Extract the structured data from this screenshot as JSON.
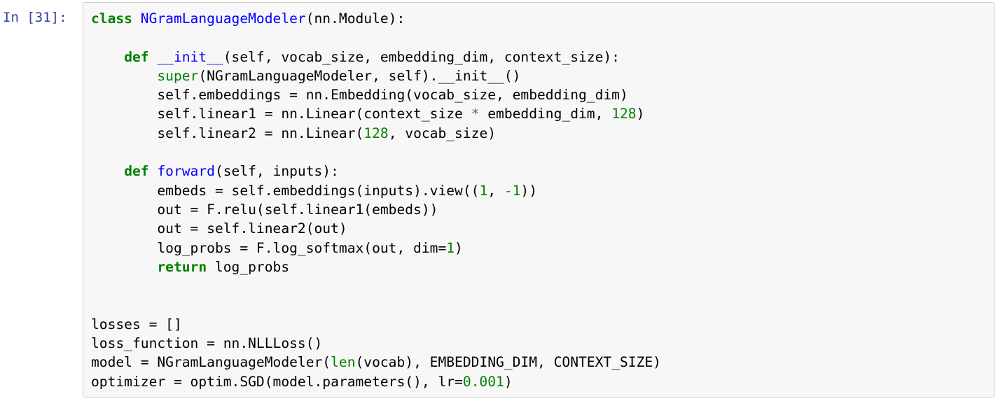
{
  "notebook": {
    "cell": {
      "prompt": "In [31]:",
      "language": "python",
      "lines": [
        [
          {
            "t": "kw",
            "v": "class"
          },
          {
            "t": "",
            "v": " "
          },
          {
            "t": "cls",
            "v": "NGramLanguageModeler"
          },
          {
            "t": "",
            "v": "(nn.Module):"
          }
        ],
        [],
        [
          {
            "t": "",
            "v": "    "
          },
          {
            "t": "kw",
            "v": "def"
          },
          {
            "t": "",
            "v": " "
          },
          {
            "t": "fn",
            "v": "__init__"
          },
          {
            "t": "",
            "v": "(self, vocab_size, embedding_dim, context_size):"
          }
        ],
        [
          {
            "t": "",
            "v": "        "
          },
          {
            "t": "bi",
            "v": "super"
          },
          {
            "t": "",
            "v": "(NGramLanguageModeler, self).__init__()"
          }
        ],
        [
          {
            "t": "",
            "v": "        self.embeddings = nn.Embedding(vocab_size, embedding_dim)"
          }
        ],
        [
          {
            "t": "",
            "v": "        self.linear1 = nn.Linear(context_size "
          },
          {
            "t": "op",
            "v": "*"
          },
          {
            "t": "",
            "v": " embedding_dim, "
          },
          {
            "t": "num",
            "v": "128"
          },
          {
            "t": "",
            "v": ")"
          }
        ],
        [
          {
            "t": "",
            "v": "        self.linear2 = nn.Linear("
          },
          {
            "t": "num",
            "v": "128"
          },
          {
            "t": "",
            "v": ", vocab_size)"
          }
        ],
        [],
        [
          {
            "t": "",
            "v": "    "
          },
          {
            "t": "kw",
            "v": "def"
          },
          {
            "t": "",
            "v": " "
          },
          {
            "t": "fn",
            "v": "forward"
          },
          {
            "t": "",
            "v": "(self, inputs):"
          }
        ],
        [
          {
            "t": "",
            "v": "        embeds = self.embeddings(inputs).view(("
          },
          {
            "t": "num",
            "v": "1"
          },
          {
            "t": "",
            "v": ", "
          },
          {
            "t": "op",
            "v": "-"
          },
          {
            "t": "num",
            "v": "1"
          },
          {
            "t": "",
            "v": "))"
          }
        ],
        [
          {
            "t": "",
            "v": "        out = F.relu(self.linear1(embeds))"
          }
        ],
        [
          {
            "t": "",
            "v": "        out = self.linear2(out)"
          }
        ],
        [
          {
            "t": "",
            "v": "        log_probs = F.log_softmax(out, dim="
          },
          {
            "t": "num",
            "v": "1"
          },
          {
            "t": "",
            "v": ")"
          }
        ],
        [
          {
            "t": "",
            "v": "        "
          },
          {
            "t": "kw",
            "v": "return"
          },
          {
            "t": "",
            "v": " log_probs"
          }
        ],
        [],
        [],
        [
          {
            "t": "",
            "v": "losses = []"
          }
        ],
        [
          {
            "t": "",
            "v": "loss_function = nn.NLLLoss()"
          }
        ],
        [
          {
            "t": "",
            "v": "model = NGramLanguageModeler("
          },
          {
            "t": "bi",
            "v": "len"
          },
          {
            "t": "",
            "v": "(vocab), EMBEDDING_DIM, CONTEXT_SIZE)"
          }
        ],
        [
          {
            "t": "",
            "v": "optimizer = optim.SGD(model.parameters(), lr="
          },
          {
            "t": "num",
            "v": "0.001"
          },
          {
            "t": "",
            "v": ")"
          }
        ]
      ]
    }
  }
}
